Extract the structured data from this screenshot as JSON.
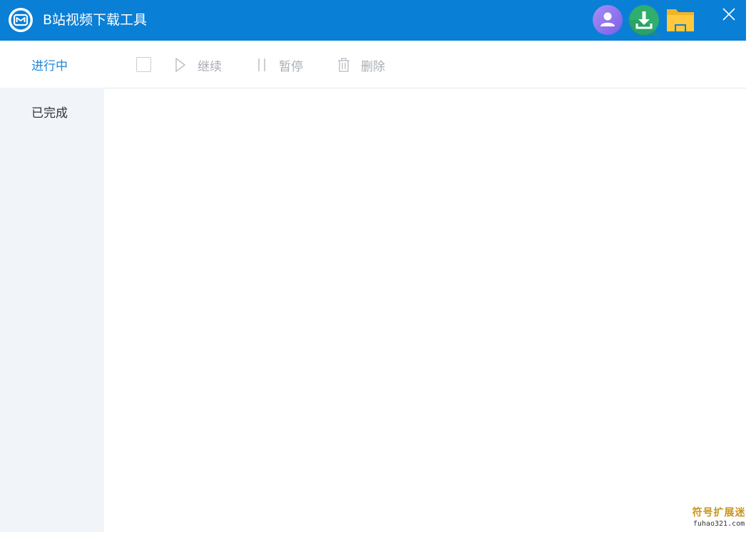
{
  "app": {
    "title": "B站视频下载工具",
    "logo_icon": "bilibili-logo-icon",
    "colors": {
      "titlebar": "#0a7fd6",
      "accent": "#1f86db",
      "sidebar_bg": "#f1f5fa"
    }
  },
  "titlebar": {
    "user_icon": "user-avatar-icon",
    "download_icon": "download-icon",
    "folder_icon": "folder-icon",
    "close_icon": "close-icon"
  },
  "sidebar": {
    "items": [
      {
        "label": "进行中",
        "active": true
      },
      {
        "label": "已完成",
        "active": false
      }
    ]
  },
  "toolbar": {
    "continue_label": "继续",
    "pause_label": "暂停",
    "delete_label": "删除"
  },
  "watermark": {
    "line1": "符号扩展迷",
    "line2": "fuhao321.com"
  }
}
